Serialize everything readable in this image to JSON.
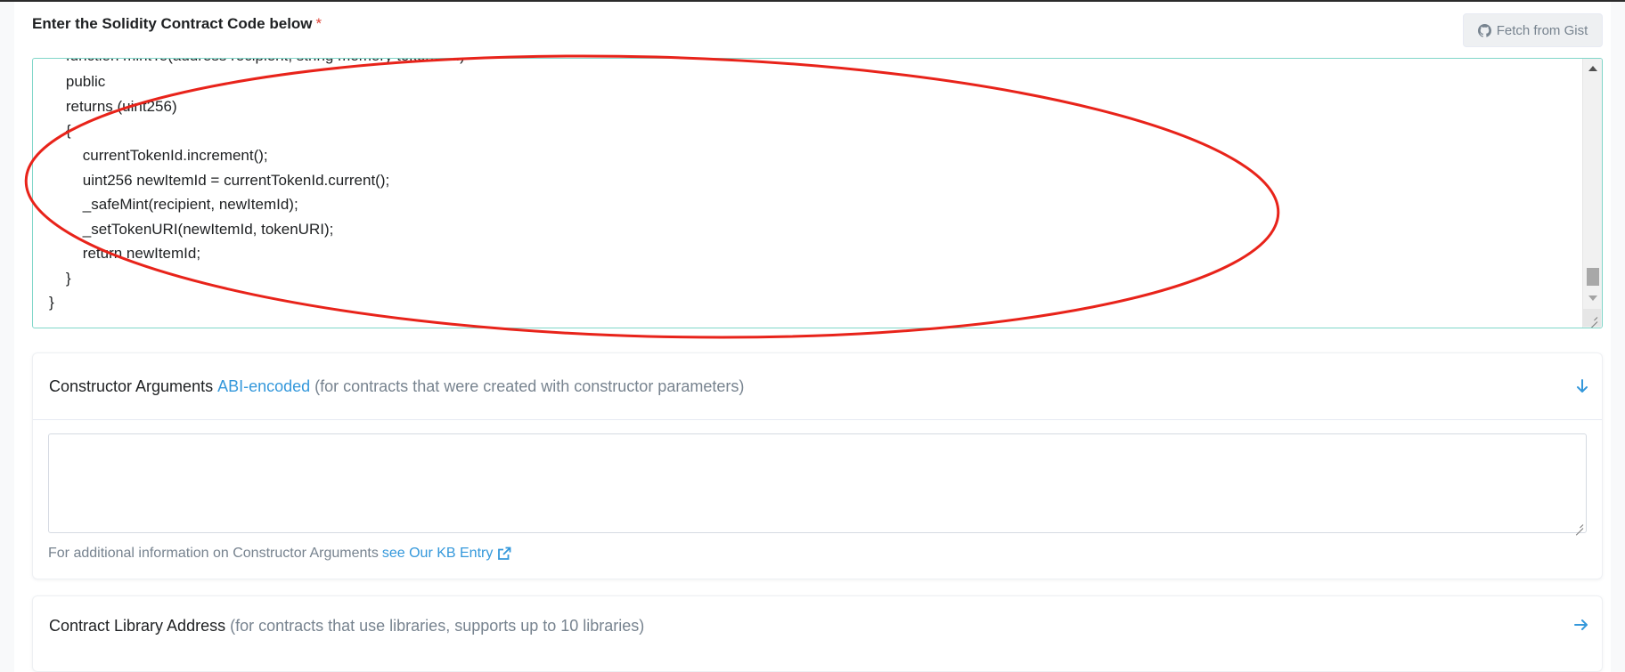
{
  "code_section": {
    "label": "Enter the Solidity Contract Code below",
    "required_mark": "*",
    "fetch_button": "Fetch from Gist",
    "code_lines": [
      "    function mintTo(address recipient, string memory tokenURI)",
      "    public",
      "    returns (uint256)",
      "    {",
      "        currentTokenId.increment();",
      "        uint256 newItemId = currentTokenId.current();",
      "        _safeMint(recipient, newItemId);",
      "        _setTokenURI(newItemId, tokenURI);",
      "        return newItemId;",
      "    }",
      "}"
    ]
  },
  "constructor_section": {
    "title": "Constructor Arguments",
    "link": "ABI-encoded",
    "description": "(for contracts that were created with constructor parameters)",
    "input_value": "",
    "info_text": "For additional information on Constructor Arguments",
    "kb_link": "see Our KB Entry"
  },
  "library_section": {
    "title": "Contract Library Address",
    "description": "(for contracts that use libraries, supports up to 10 libraries)"
  },
  "colors": {
    "accent": "#3498db",
    "required": "#de4437",
    "annotation": "#e8231a",
    "code_border": "#80d6c9"
  }
}
